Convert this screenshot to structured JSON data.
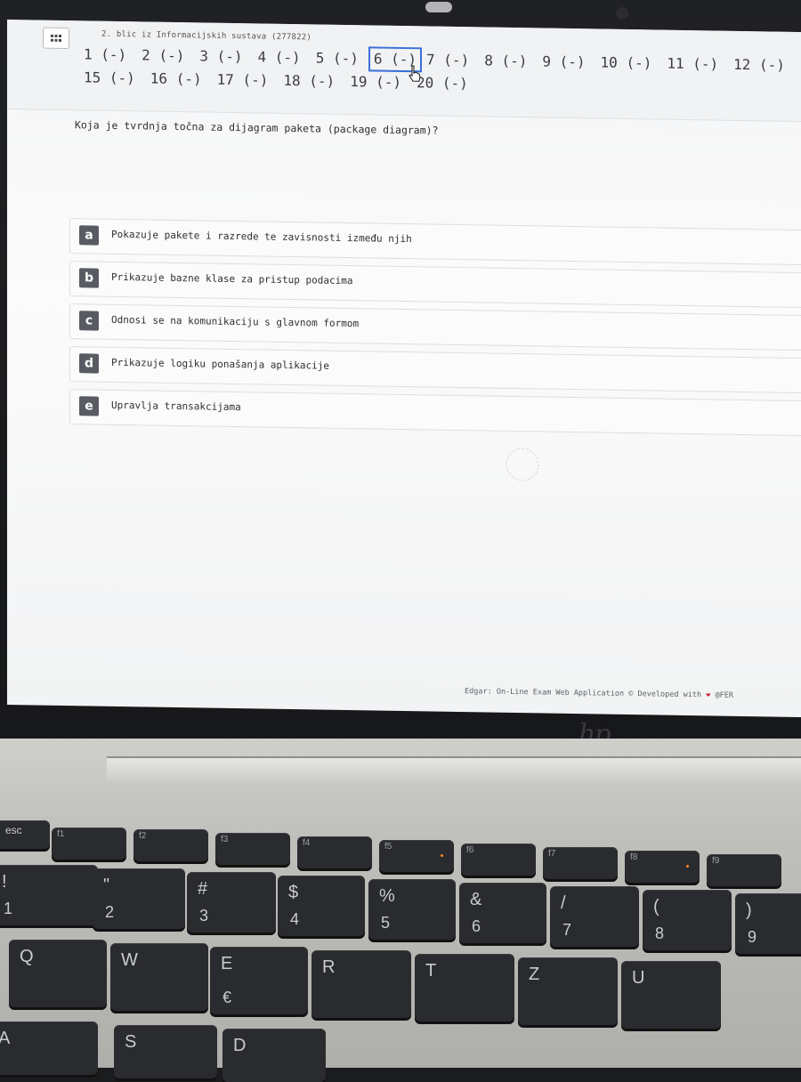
{
  "exam": {
    "title": "2. blic iz Informacijskih sustava (277822)"
  },
  "questions_nav": [
    {
      "label": "1 (-)"
    },
    {
      "label": "2 (-)"
    },
    {
      "label": "3 (-)"
    },
    {
      "label": "4 (-)"
    },
    {
      "label": "5 (-)"
    },
    {
      "label": "6 (-)",
      "active": true
    },
    {
      "label": "7 (-)"
    },
    {
      "label": "8 (-)"
    },
    {
      "label": "9 (-)"
    },
    {
      "label": "10 (-)"
    },
    {
      "label": "11 (-)"
    },
    {
      "label": "12 (-)"
    },
    {
      "label": "15 (-)"
    },
    {
      "label": "16 (-)"
    },
    {
      "label": "17 (-)"
    },
    {
      "label": "18 (-)"
    },
    {
      "label": "19 (-)"
    },
    {
      "label": "20 (-)"
    }
  ],
  "question": {
    "text": "Koja je tvrdnja točna za dijagram paketa (package diagram)?"
  },
  "answers": [
    {
      "letter": "a",
      "text": "Pokazuje pakete i razrede te zavisnosti između njih"
    },
    {
      "letter": "b",
      "text": "Prikazuje bazne klase za pristup podacima"
    },
    {
      "letter": "c",
      "text": "Odnosi se na komunikaciju s glavnom formom"
    },
    {
      "letter": "d",
      "text": "Prikazuje logiku ponašanja aplikacije"
    },
    {
      "letter": "e",
      "text": "Upravlja transakcijama"
    }
  ],
  "footer": {
    "prefix": "Edgar: On-Line Exam Web Application © Developed with",
    "suffix": "@FER"
  },
  "laptop": {
    "brand": "hp",
    "keys": [
      {
        "label": "esc"
      },
      {
        "sub": "f1"
      },
      {
        "sub": "f2"
      },
      {
        "sub": "f3"
      },
      {
        "sub": "f4"
      },
      {
        "sub": "f5"
      },
      {
        "sub": "f6"
      },
      {
        "sub": "f7"
      },
      {
        "sub": "f8"
      },
      {
        "sub": "f9"
      },
      {
        "label": "!",
        "sub": "1"
      },
      {
        "label": "\"",
        "sub": "2"
      },
      {
        "label": "#",
        "sub": "3"
      },
      {
        "label": "$",
        "sub": "4"
      },
      {
        "label": "%",
        "sub": "5"
      },
      {
        "label": "&",
        "sub": "6"
      },
      {
        "label": "/",
        "sub": "7"
      },
      {
        "label": "(",
        "sub": "8"
      },
      {
        "label": ")",
        "sub": "9"
      },
      {
        "label": "Q"
      },
      {
        "label": "W"
      },
      {
        "label": "E",
        "sub": "€"
      },
      {
        "label": "R"
      },
      {
        "label": "T"
      },
      {
        "label": "Z"
      },
      {
        "label": "U"
      },
      {
        "label": "A"
      },
      {
        "label": "S"
      },
      {
        "label": "D"
      }
    ]
  }
}
